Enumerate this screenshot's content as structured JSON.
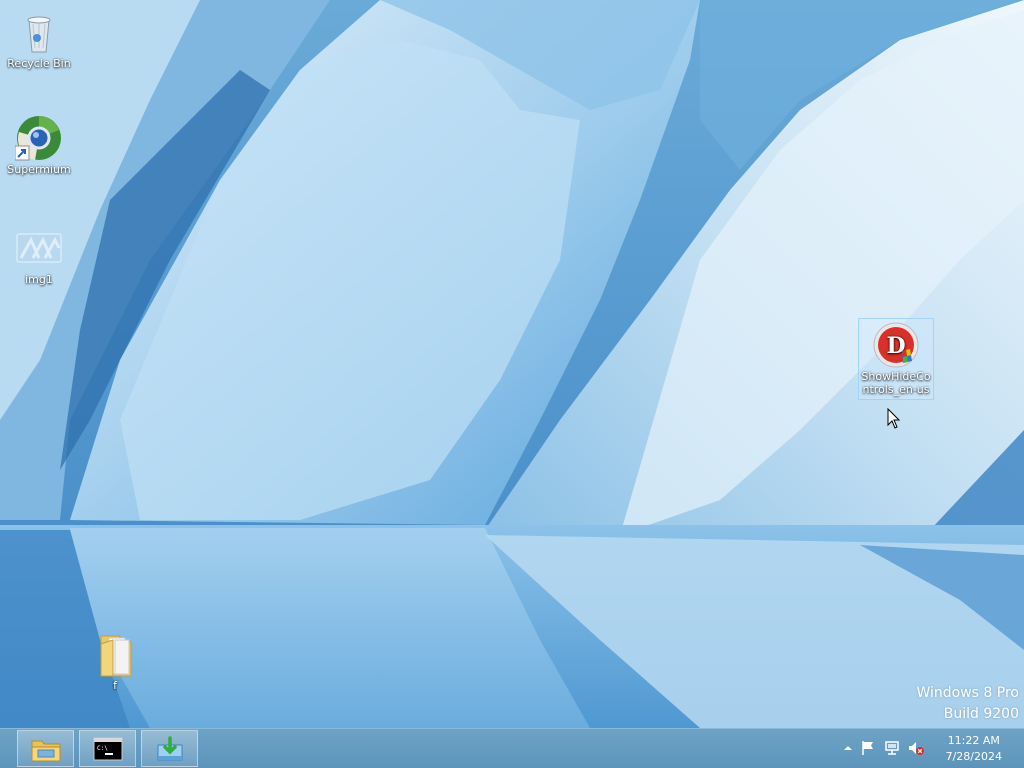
{
  "desktop": {
    "icons": [
      {
        "label": "Recycle Bin",
        "icon": "recycle-bin-icon"
      },
      {
        "label": "Supermium",
        "icon": "supermium-browser-icon"
      },
      {
        "label": "img1",
        "icon": "image-file-icon"
      },
      {
        "label": "ShowHideControls_en-us",
        "icon": "showhidecontrols-app-icon",
        "selected": true
      },
      {
        "label": "f",
        "icon": "folder-icon"
      }
    ],
    "watermark": {
      "line1": "Windows 8 Pro",
      "line2": "Build 9200"
    }
  },
  "taskbar": {
    "pinned": [
      {
        "name": "file-explorer",
        "icon": "file-explorer-icon"
      },
      {
        "name": "command-prompt",
        "icon": "command-prompt-icon"
      },
      {
        "name": "installer",
        "icon": "install-app-icon"
      }
    ],
    "tray": {
      "icons": [
        "show-hidden-icons-chevron-icon",
        "action-center-flag-icon",
        "network-icon",
        "volume-muted-icon"
      ],
      "time": "11:22 AM",
      "date": "7/28/2024"
    }
  },
  "colors": {
    "taskbar": "#6ea3c6",
    "sky": "#5a9fd0",
    "ice": "#cfe6f6"
  }
}
